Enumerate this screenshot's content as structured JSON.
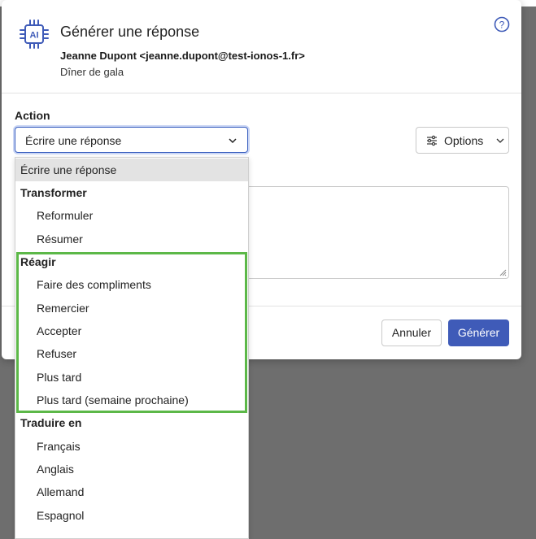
{
  "dialog": {
    "title": "Générer une réponse",
    "sender": "Jeanne Dupont <jeanne.dupont@test-ionos-1.fr>",
    "subject": "Dîner de gala",
    "ai_icon_label": "AI"
  },
  "action": {
    "label": "Action",
    "selected": "Écrire une réponse"
  },
  "options_button": {
    "label": "Options"
  },
  "footer": {
    "cancel": "Annuler",
    "generate": "Générer"
  },
  "dropdown": {
    "items": [
      {
        "kind": "option",
        "label": "Écrire une réponse",
        "selected": true
      },
      {
        "kind": "group",
        "label": "Transformer"
      },
      {
        "kind": "option",
        "label": "Reformuler"
      },
      {
        "kind": "option",
        "label": "Résumer"
      },
      {
        "kind": "group",
        "label": "Réagir"
      },
      {
        "kind": "option",
        "label": "Faire des compliments"
      },
      {
        "kind": "option",
        "label": "Remercier"
      },
      {
        "kind": "option",
        "label": "Accepter"
      },
      {
        "kind": "option",
        "label": "Refuser"
      },
      {
        "kind": "option",
        "label": "Plus tard"
      },
      {
        "kind": "option",
        "label": "Plus tard (semaine prochaine)"
      },
      {
        "kind": "group",
        "label": "Traduire en"
      },
      {
        "kind": "option",
        "label": "Français"
      },
      {
        "kind": "option",
        "label": "Anglais"
      },
      {
        "kind": "option",
        "label": "Allemand"
      },
      {
        "kind": "option",
        "label": "Espagnol"
      }
    ]
  },
  "colors": {
    "accent": "#3f5bb8",
    "highlight": "#5cb848",
    "overlay": "#6e6e6e"
  }
}
